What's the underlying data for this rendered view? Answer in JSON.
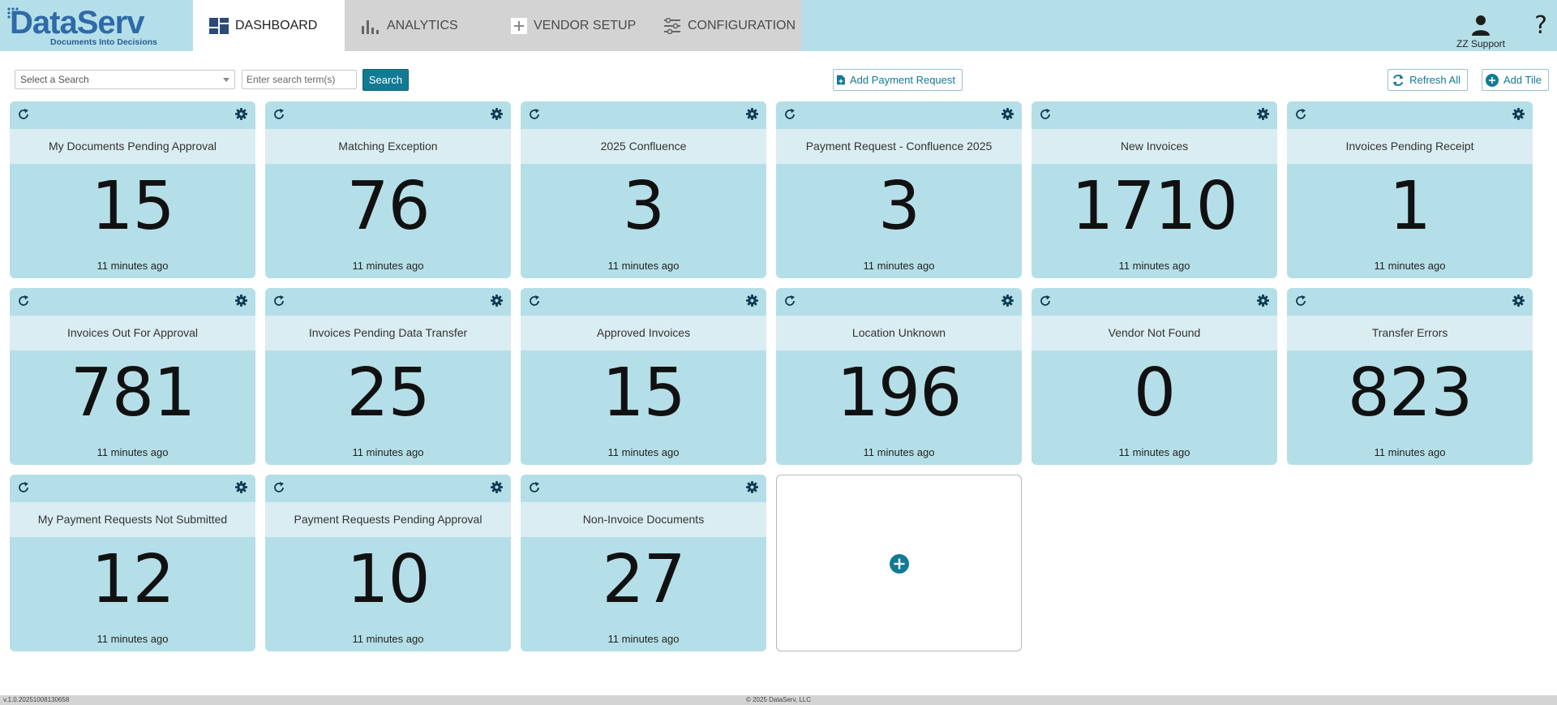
{
  "app": {
    "logo_text": "DataServ",
    "logo_tagline": "Documents Into Decisions"
  },
  "nav": {
    "tabs": [
      {
        "label": "DASHBOARD",
        "icon": "dashboard-grid-icon",
        "active": true
      },
      {
        "label": "ANALYTICS",
        "icon": "bar-chart-icon",
        "active": false
      },
      {
        "label": "VENDOR SETUP",
        "icon": "plus-square-icon",
        "active": false
      },
      {
        "label": "CONFIGURATION",
        "icon": "sliders-icon",
        "active": false
      }
    ]
  },
  "user": {
    "name": "ZZ Support",
    "icon": "user-icon",
    "help_label": "?"
  },
  "toolbar": {
    "select_search_placeholder": "Select a Search",
    "search_term_placeholder": "Enter search term(s)",
    "search_button": "Search",
    "add_payment_request": "Add Payment Request",
    "refresh_all": "Refresh All",
    "add_tile": "Add Tile"
  },
  "colors": {
    "tile_bg": "#b5dfe8",
    "tile_title_bg": "#daedf2",
    "accent": "#137a94",
    "topbar": "#b5dfe8",
    "nav_inactive": "#d3d3d3"
  },
  "tiles": [
    {
      "title": "My Documents Pending Approval",
      "count": "15",
      "updated": "11 minutes ago"
    },
    {
      "title": "Matching Exception",
      "count": "76",
      "updated": "11 minutes ago"
    },
    {
      "title": "2025 Confluence",
      "count": "3",
      "updated": "11 minutes ago"
    },
    {
      "title": "Payment Request - Confluence 2025",
      "count": "3",
      "updated": "11 minutes ago"
    },
    {
      "title": "New Invoices",
      "count": "1710",
      "updated": "11 minutes ago"
    },
    {
      "title": "Invoices Pending Receipt",
      "count": "1",
      "updated": "11 minutes ago"
    },
    {
      "title": "Invoices Out For Approval",
      "count": "781",
      "updated": "11 minutes ago"
    },
    {
      "title": "Invoices Pending Data Transfer",
      "count": "25",
      "updated": "11 minutes ago"
    },
    {
      "title": "Approved Invoices",
      "count": "15",
      "updated": "11 minutes ago"
    },
    {
      "title": "Location Unknown",
      "count": "196",
      "updated": "11 minutes ago"
    },
    {
      "title": "Vendor Not Found",
      "count": "0",
      "updated": "11 minutes ago"
    },
    {
      "title": "Transfer Errors",
      "count": "823",
      "updated": "11 minutes ago"
    },
    {
      "title": "My Payment Requests Not Submitted",
      "count": "12",
      "updated": "11 minutes ago"
    },
    {
      "title": "Payment Requests Pending Approval",
      "count": "10",
      "updated": "11 minutes ago"
    },
    {
      "title": "Non-Invoice Documents",
      "count": "27",
      "updated": "11 minutes ago"
    }
  ],
  "footer": {
    "version": "v.1.0.20251008130658",
    "copyright": "© 2025 DataServ, LLC"
  }
}
